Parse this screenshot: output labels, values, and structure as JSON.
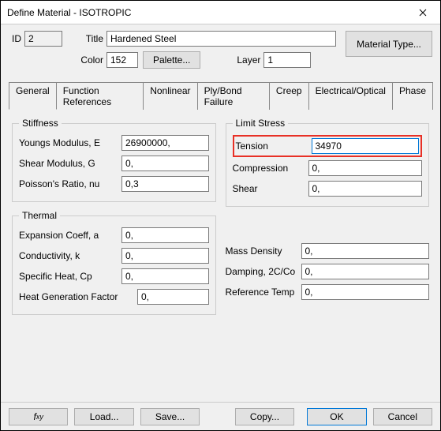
{
  "window": {
    "title": "Define Material - ISOTROPIC"
  },
  "header": {
    "id_label": "ID",
    "id_value": "2",
    "title_label": "Title",
    "title_value": "Hardened Steel",
    "color_label": "Color",
    "color_value": "152",
    "palette_btn": "Palette...",
    "layer_label": "Layer",
    "layer_value": "1",
    "material_type_btn": "Material Type..."
  },
  "tabs": [
    "General",
    "Function References",
    "Nonlinear",
    "Ply/Bond Failure",
    "Creep",
    "Electrical/Optical",
    "Phase"
  ],
  "stiffness": {
    "legend": "Stiffness",
    "youngs_label": "Youngs Modulus, E",
    "youngs_value": "26900000,",
    "shearg_label": "Shear Modulus, G",
    "shearg_value": "0,",
    "poisson_label": "Poisson's Ratio, nu",
    "poisson_value": "0,3"
  },
  "thermal": {
    "legend": "Thermal",
    "exp_label": "Expansion Coeff, a",
    "exp_value": "0,",
    "cond_label": "Conductivity, k",
    "cond_value": "0,",
    "spec_label": "Specific Heat, Cp",
    "spec_value": "0,",
    "heat_label": "Heat Generation Factor",
    "heat_value": "0,"
  },
  "limit": {
    "legend": "Limit Stress",
    "tension_label": "Tension",
    "tension_value": "34970",
    "comp_label": "Compression",
    "comp_value": "0,",
    "shear_label": "Shear",
    "shear_value": "0,"
  },
  "misc": {
    "mass_label": "Mass Density",
    "mass_value": "0,",
    "damp_label": "Damping, 2C/Co",
    "damp_value": "0,",
    "ref_label": "Reference Temp",
    "ref_value": "0,"
  },
  "footer": {
    "fxy": "f",
    "load": "Load...",
    "save": "Save...",
    "copy": "Copy...",
    "ok": "OK",
    "cancel": "Cancel"
  }
}
